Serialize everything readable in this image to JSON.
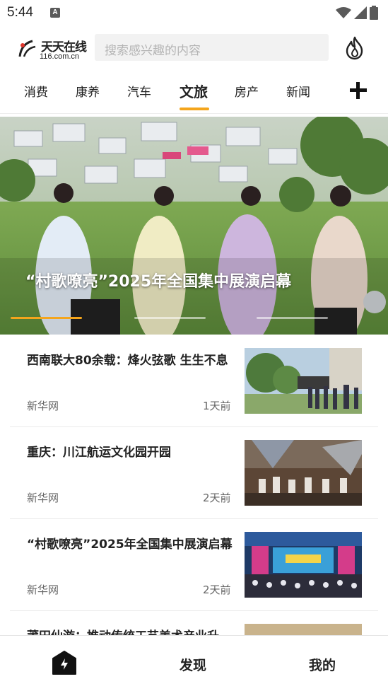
{
  "status_bar": {
    "time": "5:44",
    "notification_icon": "A"
  },
  "header": {
    "logo_text": "天天在线",
    "logo_sub": "116.com.cn",
    "search_placeholder": "搜索感兴趣的内容",
    "hot_icon": "flame-icon"
  },
  "tabs": {
    "items": [
      {
        "label": "消费"
      },
      {
        "label": "康养"
      },
      {
        "label": "汽车"
      },
      {
        "label": "文旅"
      },
      {
        "label": "房产"
      },
      {
        "label": "新闻"
      }
    ],
    "active_index": 3,
    "accent_color": "#f4a51c",
    "more_icon": "plus-icon"
  },
  "banner": {
    "title": "“村歌嘹亮”2025年全国集中展演启幕",
    "dots_count": 3,
    "active_dot": 0
  },
  "news": [
    {
      "title": "西南联大80余载：烽火弦歌 生生不息",
      "source": "新华网",
      "time": "1天前"
    },
    {
      "title": "重庆：川江航运文化园开园",
      "source": "新华网",
      "time": "2天前"
    },
    {
      "title": "“村歌嘹亮”2025年全国集中展演启幕",
      "source": "新华网",
      "time": "2天前"
    },
    {
      "title": "莆田仙游：推动传统工艺美术产业升",
      "source": "",
      "time": ""
    }
  ],
  "bottom_nav": {
    "home_icon": "home-icon",
    "discover_label": "发现",
    "mine_label": "我的"
  }
}
